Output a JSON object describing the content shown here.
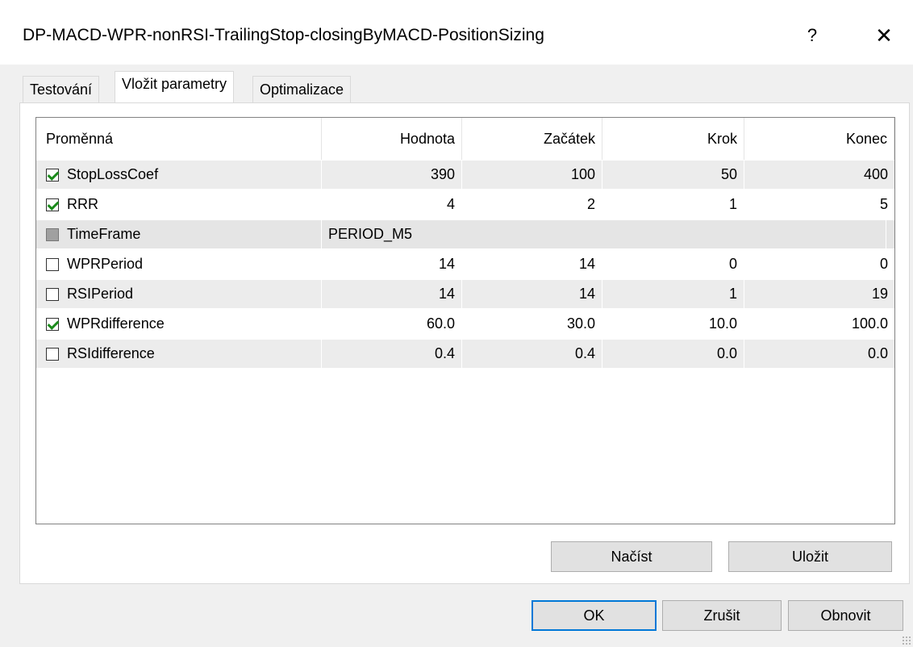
{
  "window": {
    "title": "DP-MACD-WPR-nonRSI-TrailingStop-closingByMACD-PositionSizing",
    "help_label": "?",
    "close_label": "✕"
  },
  "tabs": [
    {
      "label": "Testování",
      "active": false
    },
    {
      "label": "Vložit parametry",
      "active": true
    },
    {
      "label": "Optimalizace",
      "active": false
    }
  ],
  "grid": {
    "headers": [
      "Proměnná",
      "Hodnota",
      "Začátek",
      "Krok",
      "Konec"
    ],
    "rows": [
      {
        "name": "StopLossCoef",
        "checked": true,
        "value": "390",
        "start": "100",
        "step": "50",
        "stop": "400"
      },
      {
        "name": "RRR",
        "checked": true,
        "value": "4",
        "start": "2",
        "step": "1",
        "stop": "5"
      },
      {
        "name": "TimeFrame",
        "checked": false,
        "disabled": true,
        "value": "PERIOD_M5",
        "start": "",
        "step": "",
        "stop": ""
      },
      {
        "name": "WPRPeriod",
        "checked": false,
        "value": "14",
        "start": "14",
        "step": "0",
        "stop": "0"
      },
      {
        "name": "RSIPeriod",
        "checked": false,
        "value": "14",
        "start": "14",
        "step": "1",
        "stop": "19"
      },
      {
        "name": "WPRdifference",
        "checked": true,
        "value": "60.0",
        "start": "30.0",
        "step": "10.0",
        "stop": "100.0"
      },
      {
        "name": "RSIdifference",
        "checked": false,
        "value": "0.4",
        "start": "0.4",
        "step": "0.0",
        "stop": "0.0"
      }
    ]
  },
  "buttons": {
    "load": "Načíst",
    "save": "Uložit",
    "ok": "OK",
    "cancel": "Zrušit",
    "reset": "Obnovit"
  },
  "colors": {
    "accent": "#0078d7",
    "check": "#1a8a1a",
    "dialog_bg": "#f0f0f0"
  }
}
